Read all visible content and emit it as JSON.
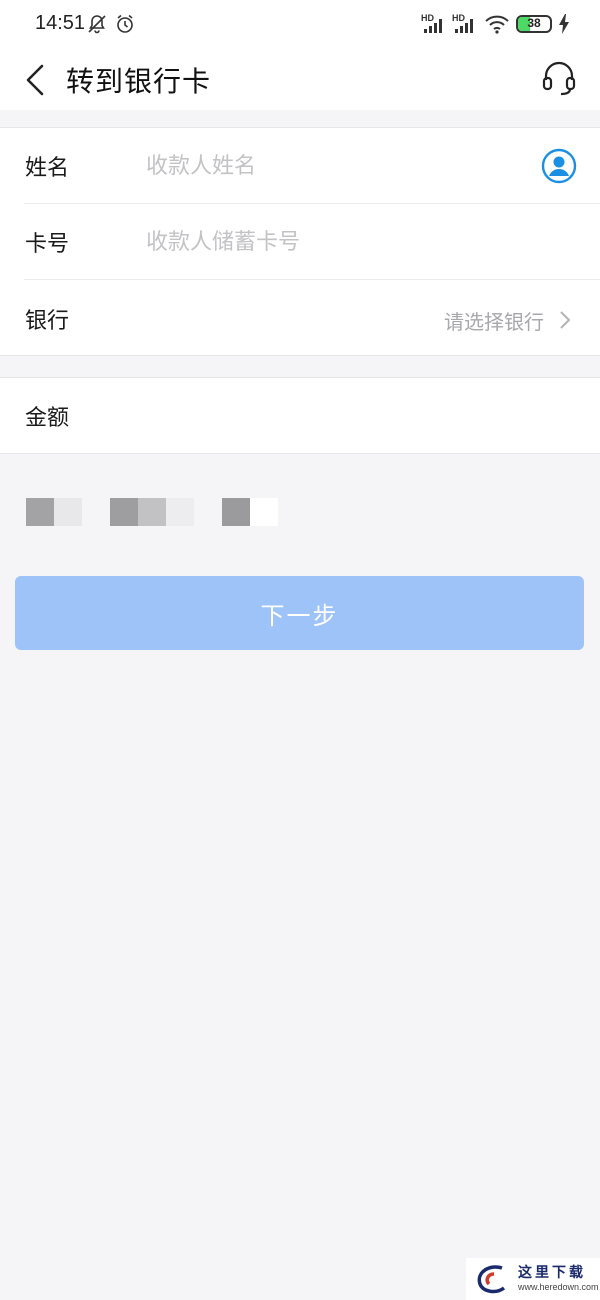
{
  "status_bar": {
    "time": "14:51",
    "network_badge_1": "HD",
    "network_badge_2": "HD",
    "battery_level": "38",
    "icons": [
      "mute-bell-icon",
      "alarm-icon",
      "signal-icon",
      "signal-icon",
      "wifi-icon",
      "battery-icon",
      "charging-icon"
    ]
  },
  "header": {
    "title": "转到银行卡",
    "back_icon": "chevron-left-icon",
    "support_icon": "headset-icon"
  },
  "form": {
    "name": {
      "label": "姓名",
      "value": "",
      "placeholder": "收款人姓名",
      "icon": "contact-person-icon"
    },
    "card_number": {
      "label": "卡号",
      "value": "",
      "placeholder": "收款人储蓄卡号"
    },
    "bank": {
      "label": "银行",
      "placeholder": "请选择银行",
      "icon": "chevron-right-icon"
    },
    "amount": {
      "label": "金额",
      "value": ""
    }
  },
  "actions": {
    "next_label": "下一步"
  },
  "watermark": {
    "text": "这里下载",
    "url": "www.heredown.com"
  },
  "colors": {
    "accent": "#1a8fe3",
    "button_disabled": "#9ec3f8",
    "background": "#f5f5f7",
    "placeholder": "#c3c3c6"
  }
}
